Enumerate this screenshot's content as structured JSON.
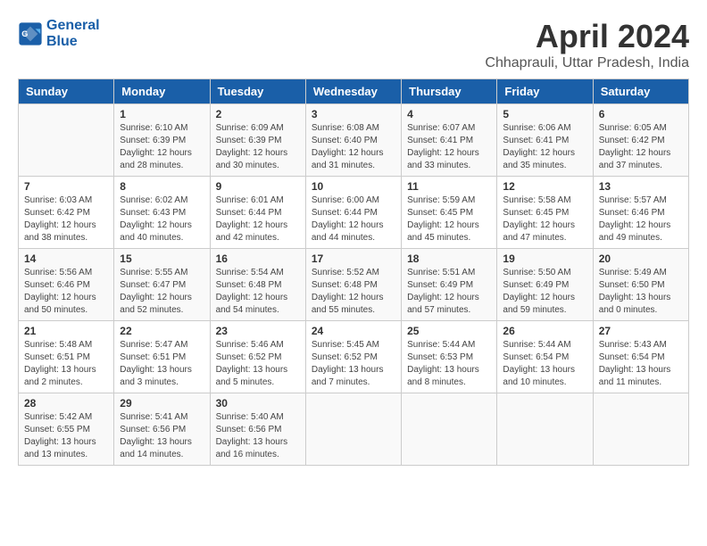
{
  "logo": {
    "line1": "General",
    "line2": "Blue"
  },
  "title": "April 2024",
  "subtitle": "Chhaprauli, Uttar Pradesh, India",
  "days_of_week": [
    "Sunday",
    "Monday",
    "Tuesday",
    "Wednesday",
    "Thursday",
    "Friday",
    "Saturday"
  ],
  "weeks": [
    [
      {
        "day": "",
        "detail": ""
      },
      {
        "day": "1",
        "detail": "Sunrise: 6:10 AM\nSunset: 6:39 PM\nDaylight: 12 hours\nand 28 minutes."
      },
      {
        "day": "2",
        "detail": "Sunrise: 6:09 AM\nSunset: 6:39 PM\nDaylight: 12 hours\nand 30 minutes."
      },
      {
        "day": "3",
        "detail": "Sunrise: 6:08 AM\nSunset: 6:40 PM\nDaylight: 12 hours\nand 31 minutes."
      },
      {
        "day": "4",
        "detail": "Sunrise: 6:07 AM\nSunset: 6:41 PM\nDaylight: 12 hours\nand 33 minutes."
      },
      {
        "day": "5",
        "detail": "Sunrise: 6:06 AM\nSunset: 6:41 PM\nDaylight: 12 hours\nand 35 minutes."
      },
      {
        "day": "6",
        "detail": "Sunrise: 6:05 AM\nSunset: 6:42 PM\nDaylight: 12 hours\nand 37 minutes."
      }
    ],
    [
      {
        "day": "7",
        "detail": "Sunrise: 6:03 AM\nSunset: 6:42 PM\nDaylight: 12 hours\nand 38 minutes."
      },
      {
        "day": "8",
        "detail": "Sunrise: 6:02 AM\nSunset: 6:43 PM\nDaylight: 12 hours\nand 40 minutes."
      },
      {
        "day": "9",
        "detail": "Sunrise: 6:01 AM\nSunset: 6:44 PM\nDaylight: 12 hours\nand 42 minutes."
      },
      {
        "day": "10",
        "detail": "Sunrise: 6:00 AM\nSunset: 6:44 PM\nDaylight: 12 hours\nand 44 minutes."
      },
      {
        "day": "11",
        "detail": "Sunrise: 5:59 AM\nSunset: 6:45 PM\nDaylight: 12 hours\nand 45 minutes."
      },
      {
        "day": "12",
        "detail": "Sunrise: 5:58 AM\nSunset: 6:45 PM\nDaylight: 12 hours\nand 47 minutes."
      },
      {
        "day": "13",
        "detail": "Sunrise: 5:57 AM\nSunset: 6:46 PM\nDaylight: 12 hours\nand 49 minutes."
      }
    ],
    [
      {
        "day": "14",
        "detail": "Sunrise: 5:56 AM\nSunset: 6:46 PM\nDaylight: 12 hours\nand 50 minutes."
      },
      {
        "day": "15",
        "detail": "Sunrise: 5:55 AM\nSunset: 6:47 PM\nDaylight: 12 hours\nand 52 minutes."
      },
      {
        "day": "16",
        "detail": "Sunrise: 5:54 AM\nSunset: 6:48 PM\nDaylight: 12 hours\nand 54 minutes."
      },
      {
        "day": "17",
        "detail": "Sunrise: 5:52 AM\nSunset: 6:48 PM\nDaylight: 12 hours\nand 55 minutes."
      },
      {
        "day": "18",
        "detail": "Sunrise: 5:51 AM\nSunset: 6:49 PM\nDaylight: 12 hours\nand 57 minutes."
      },
      {
        "day": "19",
        "detail": "Sunrise: 5:50 AM\nSunset: 6:49 PM\nDaylight: 12 hours\nand 59 minutes."
      },
      {
        "day": "20",
        "detail": "Sunrise: 5:49 AM\nSunset: 6:50 PM\nDaylight: 13 hours\nand 0 minutes."
      }
    ],
    [
      {
        "day": "21",
        "detail": "Sunrise: 5:48 AM\nSunset: 6:51 PM\nDaylight: 13 hours\nand 2 minutes."
      },
      {
        "day": "22",
        "detail": "Sunrise: 5:47 AM\nSunset: 6:51 PM\nDaylight: 13 hours\nand 3 minutes."
      },
      {
        "day": "23",
        "detail": "Sunrise: 5:46 AM\nSunset: 6:52 PM\nDaylight: 13 hours\nand 5 minutes."
      },
      {
        "day": "24",
        "detail": "Sunrise: 5:45 AM\nSunset: 6:52 PM\nDaylight: 13 hours\nand 7 minutes."
      },
      {
        "day": "25",
        "detail": "Sunrise: 5:44 AM\nSunset: 6:53 PM\nDaylight: 13 hours\nand 8 minutes."
      },
      {
        "day": "26",
        "detail": "Sunrise: 5:44 AM\nSunset: 6:54 PM\nDaylight: 13 hours\nand 10 minutes."
      },
      {
        "day": "27",
        "detail": "Sunrise: 5:43 AM\nSunset: 6:54 PM\nDaylight: 13 hours\nand 11 minutes."
      }
    ],
    [
      {
        "day": "28",
        "detail": "Sunrise: 5:42 AM\nSunset: 6:55 PM\nDaylight: 13 hours\nand 13 minutes."
      },
      {
        "day": "29",
        "detail": "Sunrise: 5:41 AM\nSunset: 6:56 PM\nDaylight: 13 hours\nand 14 minutes."
      },
      {
        "day": "30",
        "detail": "Sunrise: 5:40 AM\nSunset: 6:56 PM\nDaylight: 13 hours\nand 16 minutes."
      },
      {
        "day": "",
        "detail": ""
      },
      {
        "day": "",
        "detail": ""
      },
      {
        "day": "",
        "detail": ""
      },
      {
        "day": "",
        "detail": ""
      }
    ]
  ]
}
